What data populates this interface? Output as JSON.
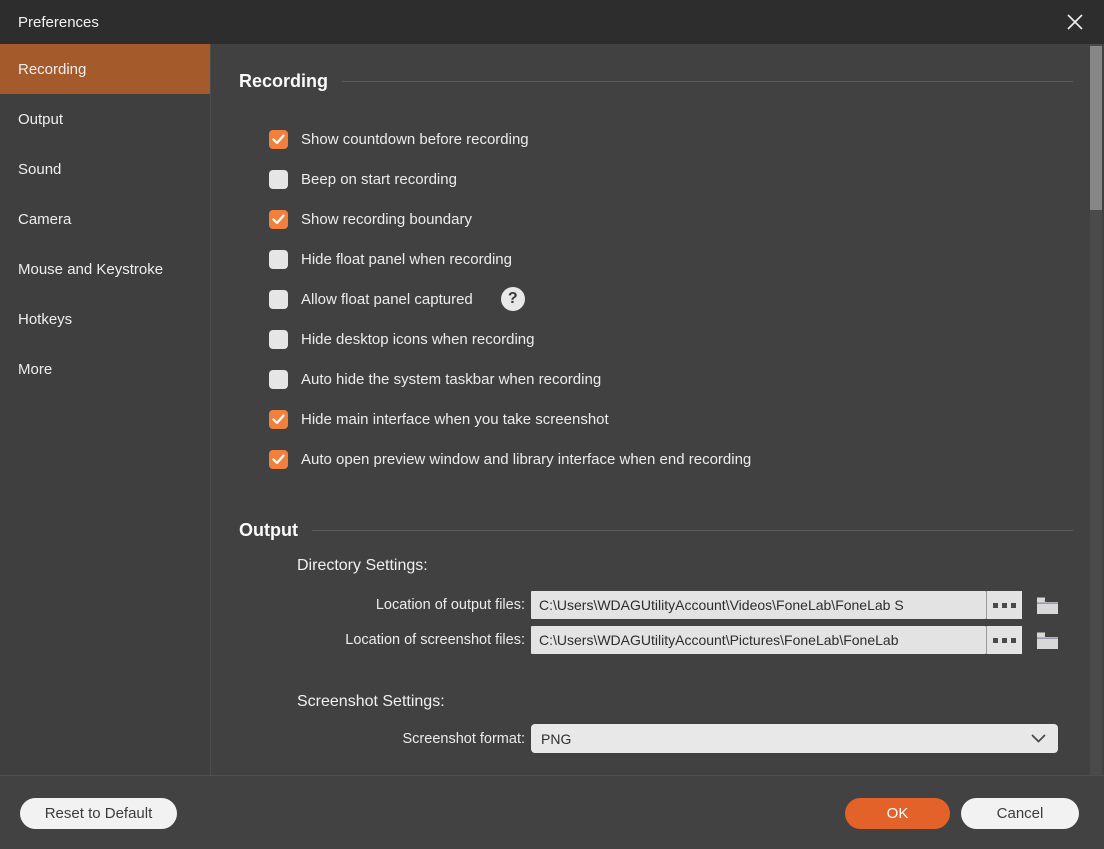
{
  "window": {
    "title": "Preferences"
  },
  "sidebar": {
    "items": [
      {
        "label": "Recording",
        "selected": true
      },
      {
        "label": "Output",
        "selected": false
      },
      {
        "label": "Sound",
        "selected": false
      },
      {
        "label": "Camera",
        "selected": false
      },
      {
        "label": "Mouse and Keystroke",
        "selected": false
      },
      {
        "label": "Hotkeys",
        "selected": false
      },
      {
        "label": "More",
        "selected": false
      }
    ]
  },
  "recording_section": {
    "heading": "Recording",
    "checkboxes": [
      {
        "label": "Show countdown before recording",
        "checked": true
      },
      {
        "label": "Beep on start recording",
        "checked": false
      },
      {
        "label": "Show recording boundary",
        "checked": true
      },
      {
        "label": "Hide float panel when recording",
        "checked": false
      },
      {
        "label": "Allow float panel captured",
        "checked": false,
        "help": true
      },
      {
        "label": "Hide desktop icons when recording",
        "checked": false
      },
      {
        "label": "Auto hide the system taskbar when recording",
        "checked": false
      },
      {
        "label": "Hide main interface when you take screenshot",
        "checked": true
      },
      {
        "label": "Auto open preview window and library interface when end recording",
        "checked": true
      }
    ],
    "help_glyph": "?"
  },
  "output_section": {
    "heading": "Output",
    "directory_heading": "Directory Settings:",
    "fields": [
      {
        "label": "Location of output files:",
        "value": "C:\\Users\\WDAGUtilityAccount\\Videos\\FoneLab\\FoneLab S"
      },
      {
        "label": "Location of screenshot files:",
        "value": "C:\\Users\\WDAGUtilityAccount\\Pictures\\FoneLab\\FoneLab"
      }
    ],
    "screenshot_heading": "Screenshot Settings:",
    "format_label": "Screenshot format:",
    "format_value": "PNG"
  },
  "footer": {
    "reset_label": "Reset to Default",
    "ok_label": "OK",
    "cancel_label": "Cancel"
  },
  "colors": {
    "accent_orange": "#f1803f",
    "selected_nav": "#a55a2b",
    "ok_button": "#e2622a",
    "titlebar_bg": "#2d2d2d",
    "panel_bg": "#414141"
  }
}
